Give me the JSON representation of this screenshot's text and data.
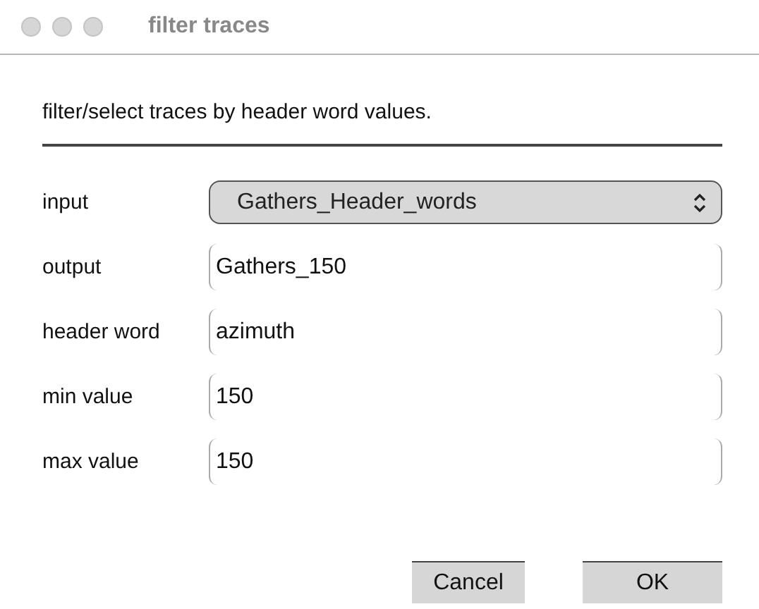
{
  "window": {
    "title": "filter traces"
  },
  "description": "filter/select traces by header word values.",
  "fields": [
    {
      "label": "input",
      "kind": "select",
      "value": "Gathers_Header_words"
    },
    {
      "label": "output",
      "kind": "text",
      "value": "Gathers_150"
    },
    {
      "label": "header word",
      "kind": "text",
      "value": "azimuth"
    },
    {
      "label": "min value",
      "kind": "text",
      "value": "150"
    },
    {
      "label": "max value",
      "kind": "text",
      "value": "150"
    }
  ],
  "buttons": [
    "Cancel",
    "OK"
  ]
}
